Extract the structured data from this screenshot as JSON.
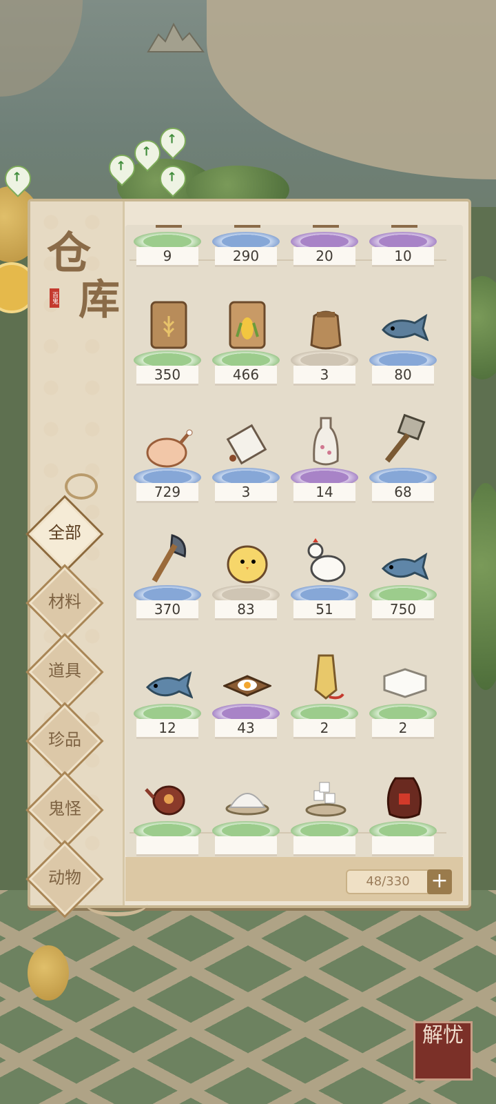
{
  "panel": {
    "title_char_1": "仓",
    "title_char_2": "库",
    "seal_text": "百鬼",
    "capacity": "48/330",
    "add_symbol": "+"
  },
  "tabs": [
    {
      "label": "全部",
      "active": true
    },
    {
      "label": "材料",
      "active": false
    },
    {
      "label": "道具",
      "active": false
    },
    {
      "label": "珍品",
      "active": false
    },
    {
      "label": "鬼怪",
      "active": false
    },
    {
      "label": "动物",
      "active": false
    }
  ],
  "items": [
    {
      "icon": "partial-item-icon",
      "count": "9",
      "disc": "green"
    },
    {
      "icon": "partial-item-icon",
      "count": "290",
      "disc": "blue"
    },
    {
      "icon": "partial-item-icon",
      "count": "20",
      "disc": "purple"
    },
    {
      "icon": "partial-item-icon",
      "count": "10",
      "disc": "purple"
    },
    {
      "icon": "wheat-bag-icon",
      "count": "350",
      "disc": "green"
    },
    {
      "icon": "corn-bag-icon",
      "count": "466",
      "disc": "green"
    },
    {
      "icon": "small-sack-icon",
      "count": "3",
      "disc": "gray"
    },
    {
      "icon": "fish-head-icon",
      "count": "80",
      "disc": "blue"
    },
    {
      "icon": "roast-chicken-icon",
      "count": "729",
      "disc": "blue"
    },
    {
      "icon": "scroll-icon",
      "count": "3",
      "disc": "blue"
    },
    {
      "icon": "wine-bottle-icon",
      "count": "14",
      "disc": "purple"
    },
    {
      "icon": "hammer-icon",
      "count": "68",
      "disc": "blue"
    },
    {
      "icon": "axe-icon",
      "count": "370",
      "disc": "blue"
    },
    {
      "icon": "chick-icon",
      "count": "83",
      "disc": "gray"
    },
    {
      "icon": "hen-icon",
      "count": "51",
      "disc": "blue"
    },
    {
      "icon": "fish-icon",
      "count": "750",
      "disc": "green"
    },
    {
      "icon": "fish-icon",
      "count": "12",
      "disc": "green"
    },
    {
      "icon": "fried-egg-board-icon",
      "count": "43",
      "disc": "purple"
    },
    {
      "icon": "talisman-icon",
      "count": "2",
      "disc": "green"
    },
    {
      "icon": "tofu-icon",
      "count": "2",
      "disc": "green"
    },
    {
      "icon": "teapot-icon",
      "count": "",
      "disc": "green"
    },
    {
      "icon": "salt-pile-icon",
      "count": "",
      "disc": "green"
    },
    {
      "icon": "sugar-cubes-icon",
      "count": "",
      "disc": "green"
    },
    {
      "icon": "wine-jar-icon",
      "count": "",
      "disc": "green"
    }
  ],
  "corner_badge": "解忧",
  "colors": {
    "panel_bg": "#ede4d3",
    "panel_border": "#c8b691",
    "disc_green": "#9ccc8c",
    "disc_blue": "#86a7d7",
    "disc_purple": "#a883c7",
    "disc_gray": "#cfc5b4",
    "badge_bg": "#7b3028"
  }
}
